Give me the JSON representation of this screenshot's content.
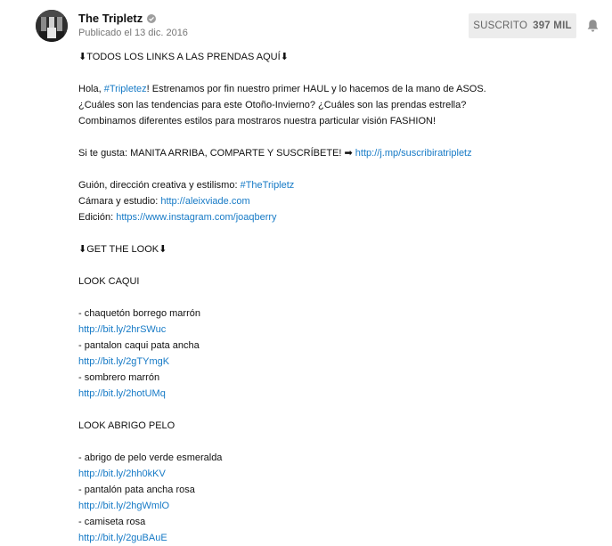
{
  "channel": {
    "name": "The Tripletz",
    "published": "Publicado el 13 dic. 2016",
    "subscribe_label": "SUSCRITO",
    "subscriber_count": "397 MIL",
    "verified_icon": "verified-check-icon",
    "bell_icon": "bell-icon"
  },
  "description": {
    "l1": "⬇TODOS LOS LINKS A LAS PRENDAS AQUÍ⬇",
    "l3_a": "Hola, ",
    "l3_link": "#Tripletez",
    "l3_b": "! Estrenamos por fin nuestro primer HAUL y lo hacemos de la mano de ASOS.",
    "l4": "¿Cuáles son las tendencias para este Otoño-Invierno? ¿Cuáles son las prendas estrella?",
    "l5": "Combinamos diferentes estilos para mostraros nuestra particular visión FASHION!",
    "l7_a": "Si te gusta: MANITA ARRIBA, COMPARTE Y SUSCRÍBETE! ➡ ",
    "l7_link": "http://j.mp/suscribiratripletz",
    "l9_a": "Guión, dirección creativa y estilismo: ",
    "l9_link": "#TheTripletz",
    "l10_a": "Cámara y estudio: ",
    "l10_link": "http://aleixviade.com",
    "l11_a": "Edición: ",
    "l11_link": "https://www.instagram.com/joaqberry",
    "l13": "⬇GET THE LOOK⬇",
    "look1_title": "LOOK CAQUI",
    "look1_item1": "- chaquetón borrego marrón",
    "look1_link1": "http://bit.ly/2hrSWuc",
    "look1_item2": "- pantalon caqui pata ancha",
    "look1_link2": "http://bit.ly/2gTYmgK",
    "look1_item3": "- sombrero marrón",
    "look1_link3": "http://bit.ly/2hotUMq",
    "look2_title": "LOOK ABRIGO PELO",
    "look2_item1": "- abrigo de pelo verde esmeralda",
    "look2_link1": "http://bit.ly/2hh0kKV",
    "look2_item2": "- pantalón pata ancha rosa",
    "look2_link2": "http://bit.ly/2hgWmlO",
    "look2_item3": "- camiseta rosa",
    "look2_link3": "http://bit.ly/2guBAuE"
  },
  "colors": {
    "link": "#167ac6",
    "subscribe_bg": "#ececec",
    "meta_text": "#767676"
  }
}
